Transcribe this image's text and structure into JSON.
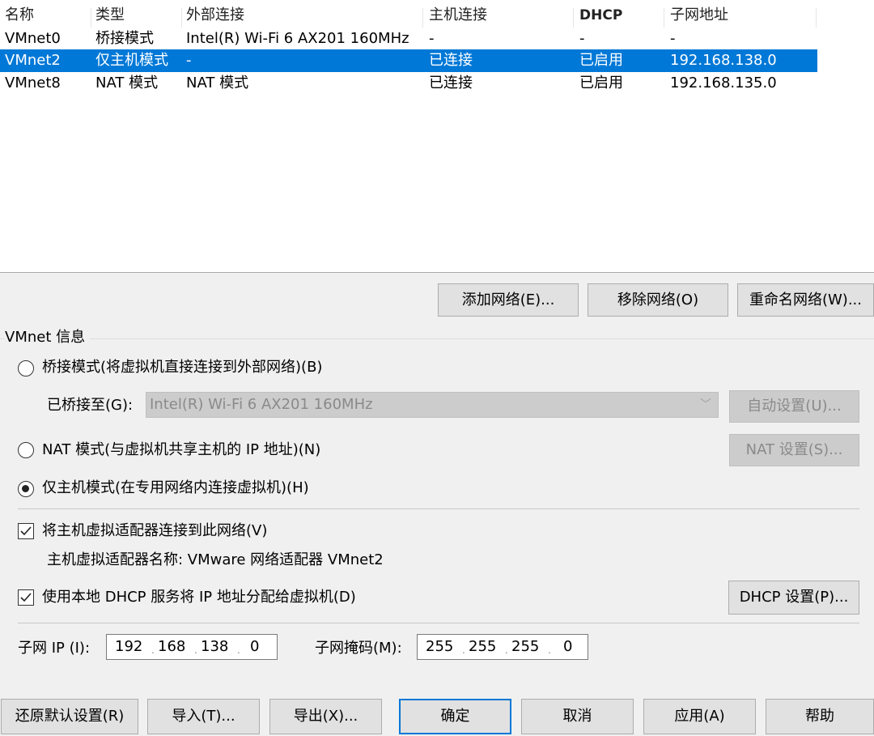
{
  "table": {
    "headers": [
      "名称",
      "类型",
      "外部连接",
      "主机连接",
      "DHCP",
      "子网地址"
    ],
    "rows": [
      [
        "VMnet0",
        "桥接模式",
        "Intel(R) Wi-Fi 6 AX201 160MHz",
        "-",
        "-",
        "-"
      ],
      [
        "VMnet2",
        "仅主机模式",
        "-",
        "已连接",
        "已启用",
        "192.168.138.0"
      ],
      [
        "VMnet8",
        "NAT 模式",
        "NAT 模式",
        "已连接",
        "已启用",
        "192.168.135.0"
      ]
    ]
  },
  "list_buttons": {
    "add": "添加网络(E)...",
    "remove": "移除网络(O)",
    "rename": "重命名网络(W)..."
  },
  "info": {
    "group_title": "VMnet 信息",
    "bridged_label": "桥接模式(将虚拟机直接连接到外部网络)(B)",
    "bridged_to_label": "已桥接至(G):",
    "bridged_to_value": "Intel(R) Wi-Fi 6 AX201 160MHz",
    "auto_settings": "自动设置(U)...",
    "nat_label": "NAT 模式(与虚拟机共享主机的 IP 地址)(N)",
    "nat_settings": "NAT 设置(S)...",
    "hostonly_label": "仅主机模式(在专用网络内连接虚拟机)(H)",
    "connect_adapter_label": "将主机虚拟适配器连接到此网络(V)",
    "adapter_name_label": "主机虚拟适配器名称: VMware 网络适配器 VMnet2",
    "dhcp_label": "使用本地 DHCP 服务将 IP 地址分配给虚拟机(D)",
    "dhcp_settings": "DHCP 设置(P)...",
    "subnet_ip_label": "子网 IP (I):",
    "subnet_ip": [
      "192",
      "168",
      "138",
      "0"
    ],
    "subnet_mask_label": "子网掩码(M):",
    "subnet_mask": [
      "255",
      "255",
      "255",
      "0"
    ]
  },
  "footer": {
    "restore": "还原默认设置(R)",
    "import": "导入(T)...",
    "export": "导出(X)...",
    "ok": "确定",
    "cancel": "取消",
    "apply": "应用(A)",
    "help": "帮助"
  },
  "colors": {
    "selection": "#0078d7",
    "background": "#f0f0f0"
  }
}
